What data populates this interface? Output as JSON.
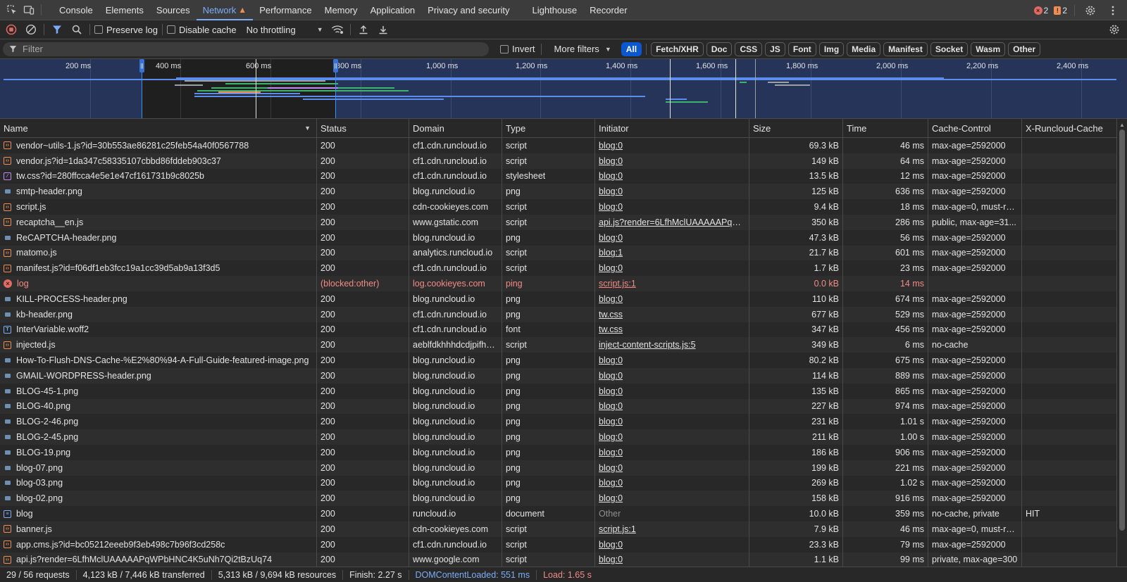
{
  "tabs": [
    {
      "label": "Console",
      "active": false
    },
    {
      "label": "Elements",
      "active": false
    },
    {
      "label": "Sources",
      "active": false
    },
    {
      "label": "Network",
      "active": true,
      "warning": true
    },
    {
      "label": "Performance",
      "active": false
    },
    {
      "label": "Memory",
      "active": false
    },
    {
      "label": "Application",
      "active": false
    },
    {
      "label": "Privacy and security",
      "active": false
    },
    {
      "label": "Lighthouse",
      "active": false
    },
    {
      "label": "Recorder",
      "active": false
    }
  ],
  "badges": {
    "errors": "2",
    "warnings": "2"
  },
  "toolbar": {
    "preserve_log": "Preserve log",
    "disable_cache": "Disable cache",
    "throttling": "No throttling"
  },
  "filter": {
    "placeholder": "Filter",
    "invert": "Invert",
    "more_filters": "More filters",
    "types": [
      "All",
      "Fetch/XHR",
      "Doc",
      "CSS",
      "JS",
      "Font",
      "Img",
      "Media",
      "Manifest",
      "Socket",
      "Wasm",
      "Other"
    ],
    "active_type": "All"
  },
  "overview": {
    "ticks": [
      "200 ms",
      "400 ms",
      "600 ms",
      "800 ms",
      "1,000 ms",
      "1,200 ms",
      "1,400 ms",
      "1,600 ms",
      "1,800 ms",
      "2,000 ms",
      "2,200 ms",
      "2,400 ms"
    ]
  },
  "columns": [
    "Name",
    "Status",
    "Domain",
    "Type",
    "Initiator",
    "Size",
    "Time",
    "Cache-Control",
    "X-Runcloud-Cache"
  ],
  "rows": [
    {
      "icon": "script",
      "name": "vendor~utils-1.js?id=30b553ae86281c25feb54a40f0567788",
      "status": "200",
      "domain": "cf1.cdn.runcloud.io",
      "type": "script",
      "initiator": "blog:0",
      "size": "69.3 kB",
      "time": "46 ms",
      "cache": "max-age=2592000",
      "xrc": ""
    },
    {
      "icon": "script",
      "name": "vendor.js?id=1da347c58335107cbbd86fddeb903c37",
      "status": "200",
      "domain": "cf1.cdn.runcloud.io",
      "type": "script",
      "initiator": "blog:0",
      "size": "149 kB",
      "time": "64 ms",
      "cache": "max-age=2592000",
      "xrc": ""
    },
    {
      "icon": "css",
      "name": "tw.css?id=280ffcca4e5e1e47cf161731b9c8025b",
      "status": "200",
      "domain": "cf1.cdn.runcloud.io",
      "type": "stylesheet",
      "initiator": "blog:0",
      "size": "13.5 kB",
      "time": "12 ms",
      "cache": "max-age=2592000",
      "xrc": ""
    },
    {
      "icon": "img",
      "name": "smtp-header.png",
      "status": "200",
      "domain": "blog.runcloud.io",
      "type": "png",
      "initiator": "blog:0",
      "size": "125 kB",
      "time": "636 ms",
      "cache": "max-age=2592000",
      "xrc": ""
    },
    {
      "icon": "script",
      "name": "script.js",
      "status": "200",
      "domain": "cdn-cookieyes.com",
      "type": "script",
      "initiator": "blog:0",
      "size": "9.4 kB",
      "time": "18 ms",
      "cache": "max-age=0, must-re...",
      "xrc": ""
    },
    {
      "icon": "script",
      "name": "recaptcha__en.js",
      "status": "200",
      "domain": "www.gstatic.com",
      "type": "script",
      "initiator": "api.js?render=6LfhMclUAAAAAPqWPbH",
      "size": "350 kB",
      "time": "286 ms",
      "cache": "public, max-age=31...",
      "xrc": ""
    },
    {
      "icon": "img",
      "name": "ReCAPTCHA-header.png",
      "status": "200",
      "domain": "blog.runcloud.io",
      "type": "png",
      "initiator": "blog:0",
      "size": "47.3 kB",
      "time": "56 ms",
      "cache": "max-age=2592000",
      "xrc": ""
    },
    {
      "icon": "script",
      "name": "matomo.js",
      "status": "200",
      "domain": "analytics.runcloud.io",
      "type": "script",
      "initiator": "blog:1",
      "size": "21.7 kB",
      "time": "601 ms",
      "cache": "max-age=2592000",
      "xrc": ""
    },
    {
      "icon": "script",
      "name": "manifest.js?id=f06df1eb3fcc19a1cc39d5ab9a13f3d5",
      "status": "200",
      "domain": "cf1.cdn.runcloud.io",
      "type": "script",
      "initiator": "blog:0",
      "size": "1.7 kB",
      "time": "23 ms",
      "cache": "max-age=2592000",
      "xrc": ""
    },
    {
      "icon": "error",
      "name": "log",
      "status": "(blocked:other)",
      "domain": "log.cookieyes.com",
      "type": "ping",
      "initiator": "script.js:1",
      "size": "0.0 kB",
      "time": "14 ms",
      "cache": "",
      "xrc": "",
      "error": true
    },
    {
      "icon": "img",
      "name": "KILL-PROCESS-header.png",
      "status": "200",
      "domain": "blog.runcloud.io",
      "type": "png",
      "initiator": "blog:0",
      "size": "110 kB",
      "time": "674 ms",
      "cache": "max-age=2592000",
      "xrc": ""
    },
    {
      "icon": "img",
      "name": "kb-header.png",
      "status": "200",
      "domain": "cf1.cdn.runcloud.io",
      "type": "png",
      "initiator": "tw.css",
      "size": "677 kB",
      "time": "529 ms",
      "cache": "max-age=2592000",
      "xrc": ""
    },
    {
      "icon": "font",
      "name": "InterVariable.woff2",
      "status": "200",
      "domain": "cf1.cdn.runcloud.io",
      "type": "font",
      "initiator": "tw.css",
      "size": "347 kB",
      "time": "456 ms",
      "cache": "max-age=2592000",
      "xrc": ""
    },
    {
      "icon": "script",
      "name": "injected.js",
      "status": "200",
      "domain": "aeblfdkhhhdcdjpifhh...",
      "type": "script",
      "initiator": "inject-content-scripts.js:5",
      "size": "349 kB",
      "time": "6 ms",
      "cache": "no-cache",
      "xrc": ""
    },
    {
      "icon": "img",
      "name": "How-To-Flush-DNS-Cache-%E2%80%94-A-Full-Guide-featured-image.png",
      "status": "200",
      "domain": "blog.runcloud.io",
      "type": "png",
      "initiator": "blog:0",
      "size": "80.2 kB",
      "time": "675 ms",
      "cache": "max-age=2592000",
      "xrc": ""
    },
    {
      "icon": "img",
      "name": "GMAIL-WORDPRESS-header.png",
      "status": "200",
      "domain": "blog.runcloud.io",
      "type": "png",
      "initiator": "blog:0",
      "size": "114 kB",
      "time": "889 ms",
      "cache": "max-age=2592000",
      "xrc": ""
    },
    {
      "icon": "img",
      "name": "BLOG-45-1.png",
      "status": "200",
      "domain": "blog.runcloud.io",
      "type": "png",
      "initiator": "blog:0",
      "size": "135 kB",
      "time": "865 ms",
      "cache": "max-age=2592000",
      "xrc": ""
    },
    {
      "icon": "img",
      "name": "BLOG-40.png",
      "status": "200",
      "domain": "blog.runcloud.io",
      "type": "png",
      "initiator": "blog:0",
      "size": "227 kB",
      "time": "974 ms",
      "cache": "max-age=2592000",
      "xrc": ""
    },
    {
      "icon": "img",
      "name": "BLOG-2-46.png",
      "status": "200",
      "domain": "blog.runcloud.io",
      "type": "png",
      "initiator": "blog:0",
      "size": "231 kB",
      "time": "1.01 s",
      "cache": "max-age=2592000",
      "xrc": ""
    },
    {
      "icon": "img",
      "name": "BLOG-2-45.png",
      "status": "200",
      "domain": "blog.runcloud.io",
      "type": "png",
      "initiator": "blog:0",
      "size": "211 kB",
      "time": "1.00 s",
      "cache": "max-age=2592000",
      "xrc": ""
    },
    {
      "icon": "img",
      "name": "BLOG-19.png",
      "status": "200",
      "domain": "blog.runcloud.io",
      "type": "png",
      "initiator": "blog:0",
      "size": "186 kB",
      "time": "906 ms",
      "cache": "max-age=2592000",
      "xrc": ""
    },
    {
      "icon": "img",
      "name": "blog-07.png",
      "status": "200",
      "domain": "blog.runcloud.io",
      "type": "png",
      "initiator": "blog:0",
      "size": "199 kB",
      "time": "221 ms",
      "cache": "max-age=2592000",
      "xrc": ""
    },
    {
      "icon": "img",
      "name": "blog-03.png",
      "status": "200",
      "domain": "blog.runcloud.io",
      "type": "png",
      "initiator": "blog:0",
      "size": "269 kB",
      "time": "1.02 s",
      "cache": "max-age=2592000",
      "xrc": ""
    },
    {
      "icon": "img",
      "name": "blog-02.png",
      "status": "200",
      "domain": "blog.runcloud.io",
      "type": "png",
      "initiator": "blog:0",
      "size": "158 kB",
      "time": "916 ms",
      "cache": "max-age=2592000",
      "xrc": ""
    },
    {
      "icon": "doc",
      "name": "blog",
      "status": "200",
      "domain": "runcloud.io",
      "type": "document",
      "initiator": "Other",
      "size": "10.0 kB",
      "time": "359 ms",
      "cache": "no-cache, private",
      "xrc": "HIT",
      "initiator_plain": true
    },
    {
      "icon": "script",
      "name": "banner.js",
      "status": "200",
      "domain": "cdn-cookieyes.com",
      "type": "script",
      "initiator": "script.js:1",
      "size": "7.9 kB",
      "time": "46 ms",
      "cache": "max-age=0, must-re...",
      "xrc": ""
    },
    {
      "icon": "script",
      "name": "app.cms.js?id=bc05212eeeb9f3eb498c7b96f3cd258c",
      "status": "200",
      "domain": "cf1.cdn.runcloud.io",
      "type": "script",
      "initiator": "blog:0",
      "size": "23.3 kB",
      "time": "79 ms",
      "cache": "max-age=2592000",
      "xrc": ""
    },
    {
      "icon": "script",
      "name": "api.js?render=6LfhMclUAAAAAPqWPbHNC4K5uNh7Qi2tBzUq74",
      "status": "200",
      "domain": "www.google.com",
      "type": "script",
      "initiator": "blog:0",
      "size": "1.1 kB",
      "time": "99 ms",
      "cache": "private, max-age=300",
      "xrc": ""
    }
  ],
  "status": {
    "requests": "29 / 56 requests",
    "transferred": "4,123 kB / 7,446 kB transferred",
    "resources": "5,313 kB / 9,694 kB resources",
    "finish": "Finish: 2.27 s",
    "dcl": "DOMContentLoaded: 551 ms",
    "load": "Load: 1.65 s"
  }
}
